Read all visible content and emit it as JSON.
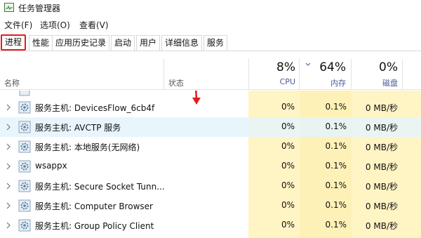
{
  "window": {
    "title": "任务管理器"
  },
  "menu": [
    "文件(F)",
    "选项(O)",
    "查看(V)"
  ],
  "tabs": [
    "进程",
    "性能",
    "应用历史记录",
    "启动",
    "用户",
    "详细信息",
    "服务"
  ],
  "header": {
    "name": "名称",
    "status": "状态",
    "cpu": {
      "pct": "8%",
      "label": "CPU"
    },
    "memory": {
      "pct": "64%",
      "label": "内存"
    },
    "disk": {
      "pct": "0%",
      "label": "磁盘"
    }
  },
  "rows": [
    {
      "name": "服务主机: DevicesFlow_6cb4f",
      "cpu": "0%",
      "memory": "0.1%",
      "disk": "0 MB/秒",
      "selected": false
    },
    {
      "name": "服务主机: AVCTP 服务",
      "cpu": "0%",
      "memory": "0.1%",
      "disk": "0 MB/秒",
      "selected": true
    },
    {
      "name": "服务主机: 本地服务(无网络)",
      "cpu": "0%",
      "memory": "0.1%",
      "disk": "0 MB/秒",
      "selected": false
    },
    {
      "name": "wsappx",
      "cpu": "0%",
      "memory": "0.1%",
      "disk": "0 MB/秒",
      "selected": false
    },
    {
      "name": "服务主机: Secure Socket Tunn...",
      "cpu": "0%",
      "memory": "0.1%",
      "disk": "0 MB/秒",
      "selected": false
    },
    {
      "name": "服务主机: Computer Browser",
      "cpu": "0%",
      "memory": "0.1%",
      "disk": "0 MB/秒",
      "selected": false
    },
    {
      "name": "服务主机: Group Policy Client",
      "cpu": "0%",
      "memory": "0.1%",
      "disk": "0 MB/秒",
      "selected": false
    }
  ],
  "colors": {
    "highlight_column": "#fff4c4",
    "highlight_column_alt": "#fef1b8",
    "selected_row": "#e5f3fb",
    "tab_outline": "#e51b1b",
    "annotation_arrow": "#e51b1b"
  },
  "icons": {
    "app": "task-manager-icon",
    "row": "gear-icon",
    "expand": "chevron-right-icon",
    "sort": "chevron-down-icon",
    "annotation": "red-arrow-down-icon"
  }
}
